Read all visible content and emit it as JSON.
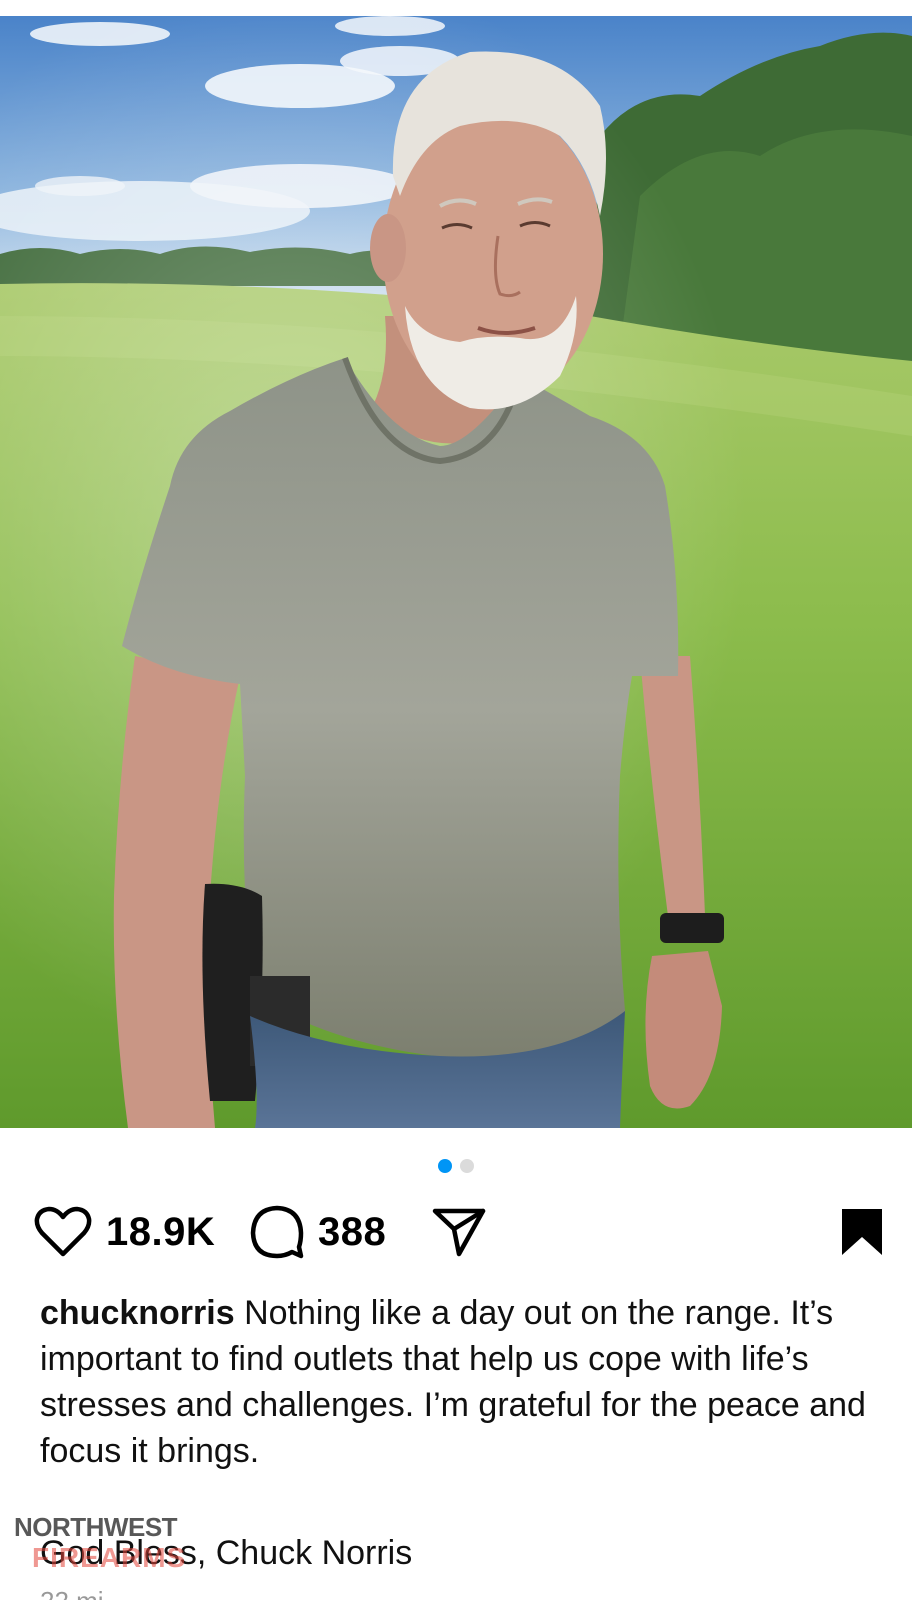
{
  "post": {
    "username": "chucknorris",
    "likes": "18.9K",
    "comments": "388",
    "caption_text": " Nothing like a day out on the range. It’s important to find outlets that help us cope with life’s stresses and challenges. I’m grateful for the peace and focus it brings.",
    "signoff": "God Bless, Chuck Norris",
    "time_peek": "22 mi",
    "carousel": {
      "total": 2,
      "current": 1
    }
  },
  "icons": {
    "like": "heart-icon",
    "comment": "comment-icon",
    "share": "send-icon",
    "save": "bookmark-icon"
  },
  "watermark": {
    "line1": "NORTHWEST",
    "line2": "FIREARMS"
  },
  "colors": {
    "accent": "#0095f6",
    "dot_inactive": "#dbdbdb",
    "watermark_red": "#e2453a"
  }
}
